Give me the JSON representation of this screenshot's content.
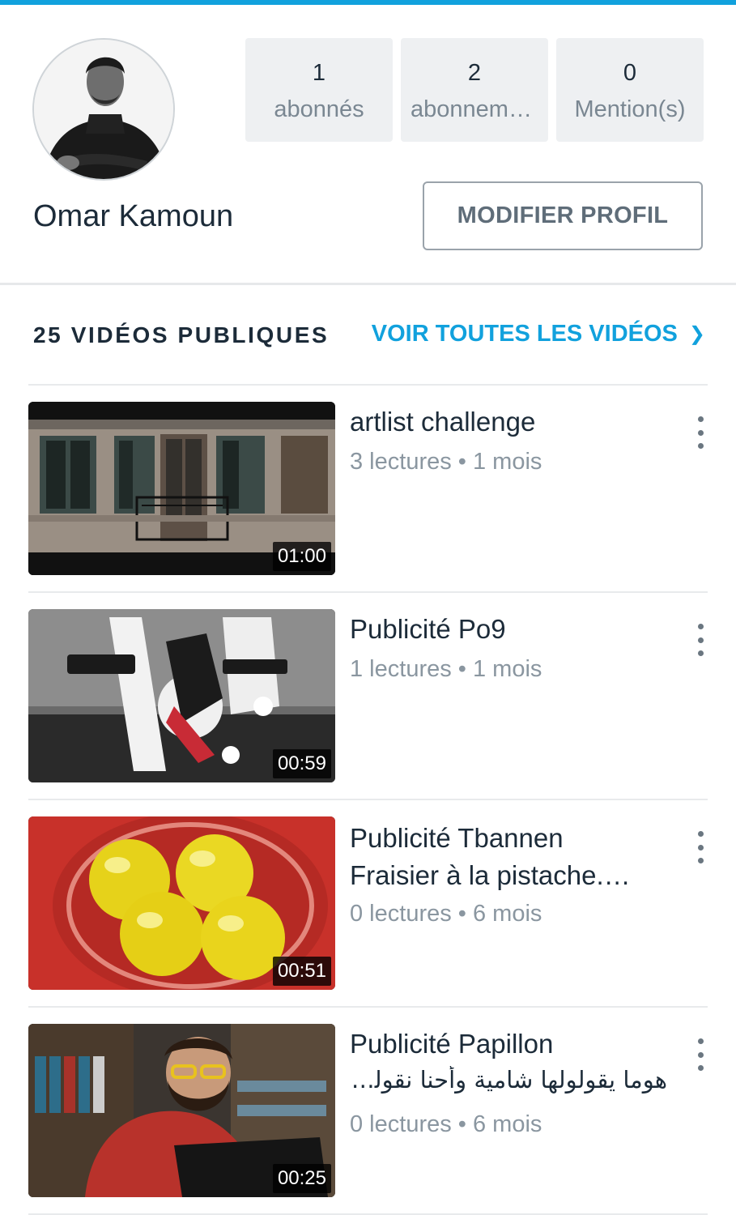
{
  "profile": {
    "name": "Omar Kamoun",
    "edit_button": "MODIFIER PROFIL",
    "stats": [
      {
        "value": "1",
        "label": "abonnés"
      },
      {
        "value": "2",
        "label": "abonnements"
      },
      {
        "value": "0",
        "label": "Mention(s)"
      }
    ]
  },
  "videos_section": {
    "count_label": "25 VIDÉOS PUBLIQUES",
    "see_all": "VOIR TOUTES LES VIDÉOS",
    "see_all_icon": "chevron-right-icon",
    "items": [
      {
        "title": "artlist challenge",
        "meta": "3 lectures • 1 mois",
        "duration": "01:00"
      },
      {
        "title": "Publicité Po9",
        "meta": "1 lectures • 1 mois",
        "duration": "00:59"
      },
      {
        "title_line1": "Publicité Tbannen",
        "title_line2": "Fraisier à la pistache.…",
        "meta": "0 lectures • 6 mois",
        "duration": "00:51"
      },
      {
        "title": "Publicité Papillon",
        "description": "هوما يقولولها شامية وأحنا نقولولها...",
        "meta": "0 lectures • 6 mois",
        "duration": "00:25"
      }
    ]
  },
  "colors": {
    "accent": "#11a1dd",
    "text": "#1c2b39",
    "muted": "#8a96a0"
  }
}
